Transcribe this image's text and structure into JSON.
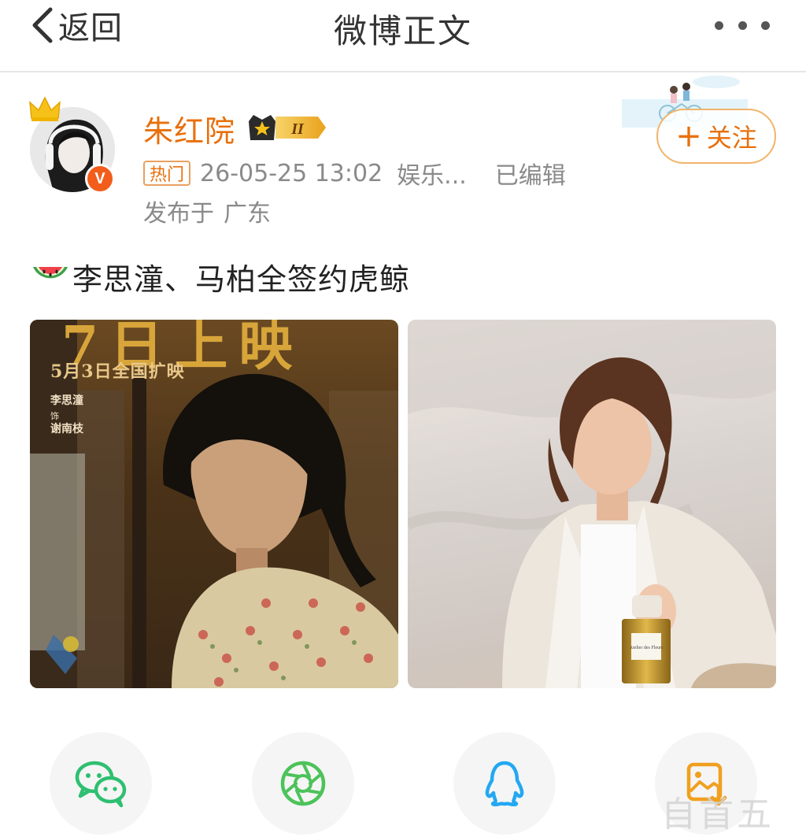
{
  "navbar": {
    "back_label": "返回",
    "title": "微博正文"
  },
  "author": {
    "name": "朱红院",
    "vip_level": "II",
    "verified_mark": "V",
    "hot_badge": "热门",
    "time": "26-05-25 13:02",
    "source": "娱乐...",
    "edited": "已编辑",
    "location_prefix": "发布于",
    "location": "广东",
    "follow_label": "关注",
    "follow_icon": "plus-icon"
  },
  "post": {
    "emoji": "watermelon-icon",
    "text": "李思潼、马柏全签约虎鲸"
  },
  "images": [
    {
      "kind": "movie-poster",
      "big_text": "7日上映",
      "date_line": "5月3日全国扩映",
      "actor": "李思潼",
      "as": "饰",
      "role": "谢南枝"
    },
    {
      "kind": "perfume-ad",
      "bottle_label": "Atelier des Fleurs"
    }
  ],
  "share": [
    {
      "name": "wechat-icon",
      "color": "#2fbf71"
    },
    {
      "name": "moments-icon",
      "color": "#4cc35a"
    },
    {
      "name": "qq-icon",
      "color": "#23a8f2"
    },
    {
      "name": "save-image-icon",
      "color": "#f0a020"
    }
  ],
  "watermark": "自首五"
}
